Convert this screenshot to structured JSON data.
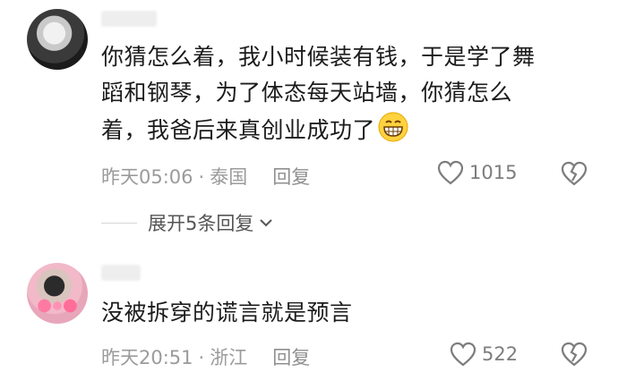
{
  "comments": [
    {
      "text_lines": [
        "你猜怎么着，我小时候装有钱，于是学了舞",
        "蹈和钢琴，为了体态每天站墙，你猜怎么",
        "着，我爸后来真创业成功了"
      ],
      "emoji": "grinning-face-icon",
      "time": "昨天05:06",
      "location": "泰国",
      "reply_label": "回复",
      "likes": "1015",
      "expand_label": "展开5条回复"
    },
    {
      "text_lines": [
        "没被拆穿的谎言就是预言"
      ],
      "time": "昨天20:51",
      "location": "浙江",
      "reply_label": "回复",
      "likes": "522"
    }
  ],
  "separator": "·"
}
